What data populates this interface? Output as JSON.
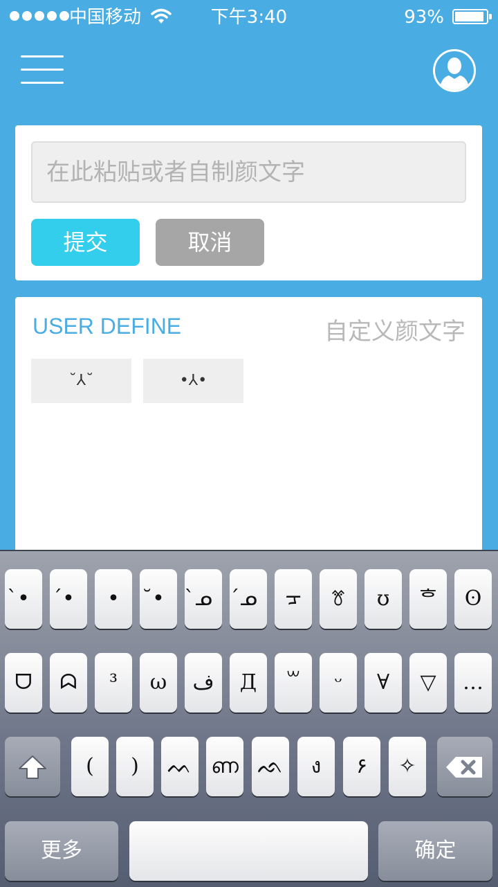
{
  "status_bar": {
    "carrier": "中国移动",
    "time": "下午3:40",
    "battery_text": "93%",
    "battery_level": 0.93
  },
  "input_card": {
    "placeholder": "在此粘贴或者自制颜文字",
    "submit_label": "提交",
    "cancel_label": "取消"
  },
  "user_define": {
    "title_en": "USER DEFINE",
    "title_cn": "自定义颜文字",
    "items": [
      "˘⅄˘",
      "•⅄•"
    ]
  },
  "keyboard": {
    "row1": [
      "̀•",
      "́•",
      "•",
      "̆•",
      "̀ᓄ",
      "́ᓄ",
      "ᠴ",
      "ꔢ",
      "ʊ",
      "ᄒ",
      "ʘ"
    ],
    "row2": [
      "ᗜ",
      "ᗣ",
      "³",
      "ω",
      "ف",
      "Д",
      "꒳",
      "ᵕ",
      "∀",
      "▽",
      "…"
    ],
    "row3": [
      "(",
      ")",
      "ᨓ",
      "ണ",
      "ᨒ",
      "ง",
      "۶",
      "✧"
    ],
    "more_label": "更多",
    "confirm_label": "确定"
  },
  "colors": {
    "primary_blue": "#49ade4",
    "submit_cyan": "#33ceec",
    "cancel_gray": "#a6a6a6"
  },
  "icons": [
    "menu-icon",
    "user-avatar-icon",
    "wifi-icon",
    "battery-icon",
    "shift-icon",
    "delete-icon"
  ]
}
